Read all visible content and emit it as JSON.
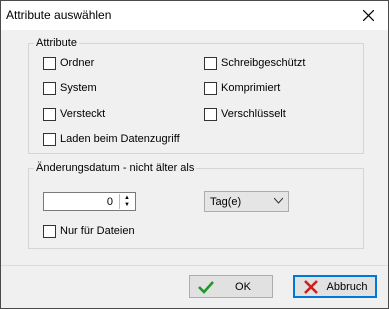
{
  "window": {
    "title": "Attribute auswählen"
  },
  "attributes": {
    "legend": "Attribute",
    "left": [
      "Ordner",
      "System",
      "Versteckt",
      "Laden beim Datenzugriff"
    ],
    "right": [
      "Schreibgeschützt",
      "Komprimiert",
      "Verschlüsselt"
    ]
  },
  "date": {
    "legend": "Änderungsdatum - nicht älter als",
    "value": "0",
    "unit": "Tag(e)",
    "files_only_label": "Nur für Dateien"
  },
  "buttons": {
    "ok": "OK",
    "cancel": "Abbruch"
  },
  "colors": {
    "ok_check": "#1a9a2a",
    "cancel_x": "#d21d1d",
    "focus_border": "#0078d7"
  }
}
